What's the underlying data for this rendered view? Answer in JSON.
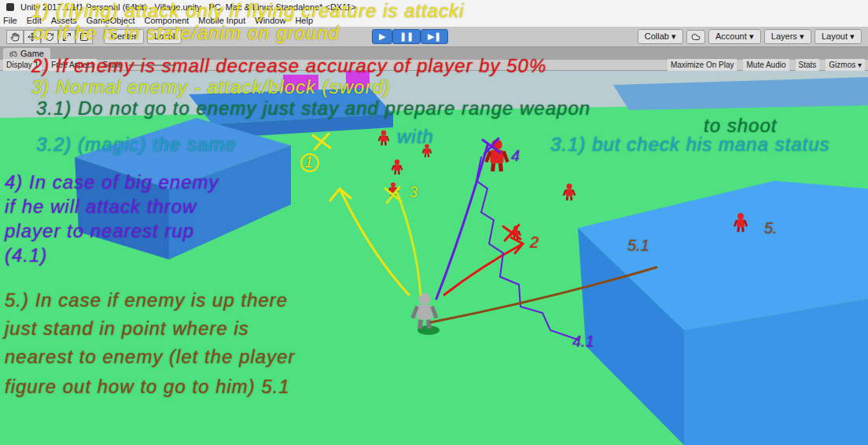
{
  "window": {
    "title": "Unity 2017.1.1f1 Personal (64bit) - Village.unity - PC, Mac & Linux Standalone* <DX11>"
  },
  "menu": [
    "File",
    "Edit",
    "Assets",
    "GameObject",
    "Component",
    "Mobile Input",
    "Window",
    "Help"
  ],
  "toolbar": {
    "pivot": "Center",
    "space": "Local",
    "play": "▶",
    "pause": "❚❚",
    "step": "▶❚",
    "playing": true,
    "collab": "Collab ▾",
    "account": "Account ▾",
    "layers": "Layers ▾",
    "layout": "Layout ▾"
  },
  "tabs": [
    {
      "label": "Game",
      "selected": true
    }
  ],
  "game_bar": {
    "display": "Display 1",
    "aspect": "Free Aspect",
    "scale": "Scale",
    "options": [
      {
        "label": "Maximize On Play",
        "on": false
      },
      {
        "label": "Mute Audio",
        "on": false
      },
      {
        "label": "Stats",
        "on": false
      },
      {
        "label": "Gizmos ▾",
        "on": false
      }
    ]
  },
  "notes": [
    {
      "text": "1) (flying) attack only if flying creature is attacki",
      "color": "#f2e20e"
    },
    {
      "text": "or if he is in state/anim on ground",
      "color": "#f2e20e"
    },
    {
      "text": "2) If enemy is small decrease accuracy of player by 50%",
      "color": "#e81414"
    },
    {
      "text": "3) Normal enemy - attack/block (sword)",
      "color": "#d2e81c"
    },
    {
      "text": "3.1) Do not go to enemy just stay and prepare range weapon",
      "color": "#0b7a3a"
    },
    {
      "text": "to shoot",
      "color": "#0b7a3a"
    },
    {
      "text": "3.2) (magic) the same",
      "color": "#1aa6c6"
    },
    {
      "text": "with",
      "color": "#1aa6c6"
    },
    {
      "text": "3.1) but check his mana status",
      "color": "#1aa6c6"
    },
    {
      "text": "4) In case of big enemy",
      "color": "#6a1ae0"
    },
    {
      "text": "if he will attack throw",
      "color": "#6a1ae0"
    },
    {
      "text": "player to nearest rup",
      "color": "#6a1ae0"
    },
    {
      "text": "(4.1)",
      "color": "#6a1ae0"
    },
    {
      "text": "5.) In case if enemy is up there",
      "color": "#8a4a14"
    },
    {
      "text": "just stand in point where is",
      "color": "#8a4a14"
    },
    {
      "text": "nearest to enemy (let the player",
      "color": "#8a4a14"
    },
    {
      "text": "figure out how to go to him) 5.1",
      "color": "#8a4a14"
    }
  ],
  "markers": [
    {
      "label": "1",
      "color": "#f2e20e"
    },
    {
      "label": "2",
      "color": "#e81414"
    },
    {
      "label": "3",
      "color": "#d2e81c"
    },
    {
      "label": "4",
      "color": "#6a1ae0"
    },
    {
      "label": "5.",
      "color": "#8a4a14"
    },
    {
      "label": "5.1",
      "color": "#8a4a14"
    },
    {
      "label": "4.1",
      "color": "#6a1ae0"
    }
  ]
}
